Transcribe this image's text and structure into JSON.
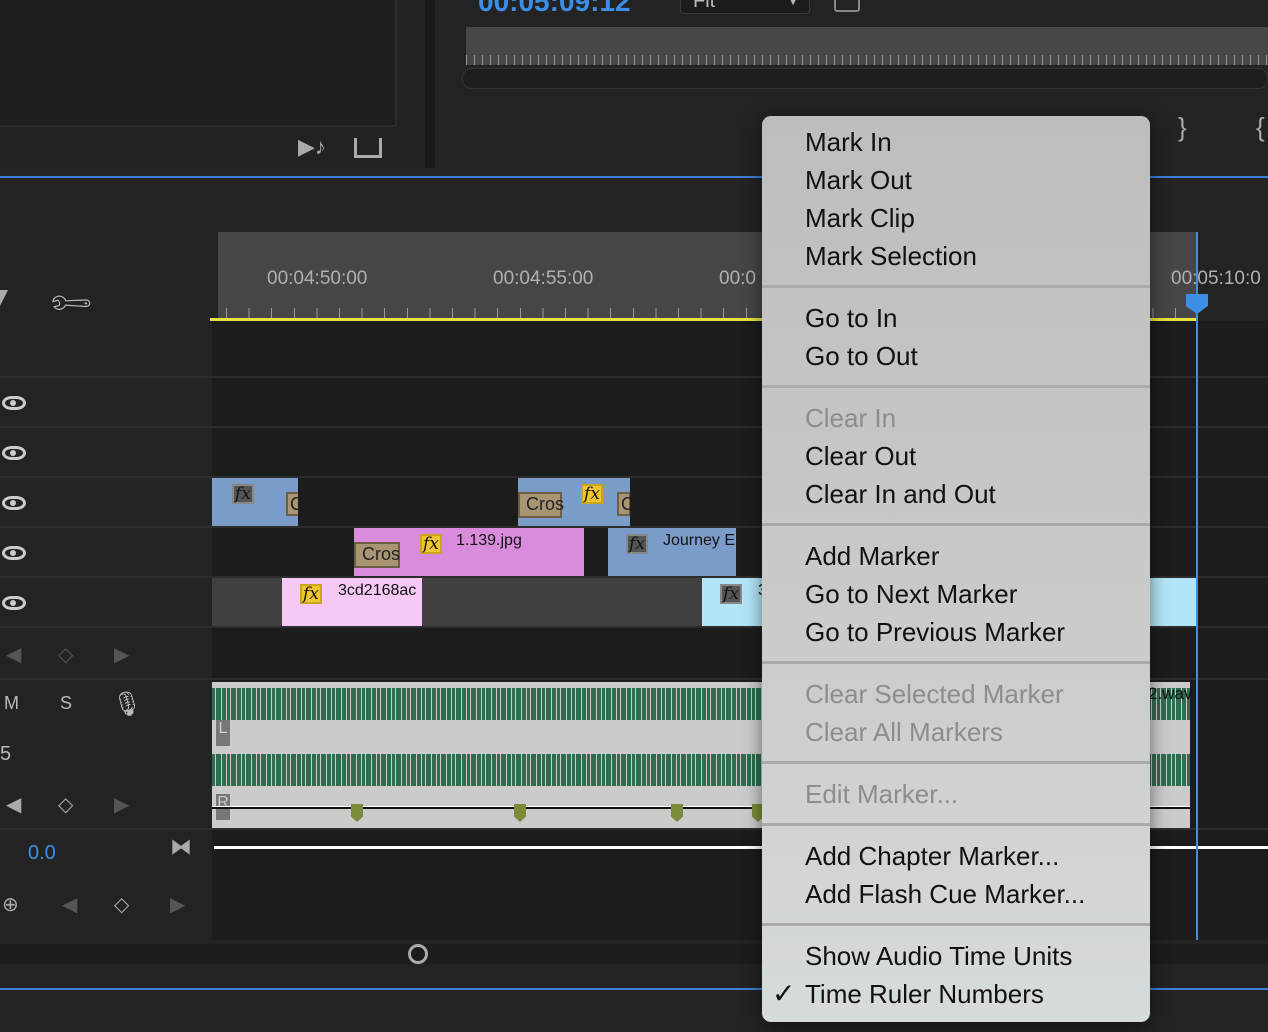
{
  "program_monitor": {
    "timecode": "00:05:09:12",
    "zoom_select": "Fit"
  },
  "timeline": {
    "ruler_labels": [
      "00:04:50:00",
      "00:04:55:00",
      "00:0",
      "00:05:10:0"
    ],
    "clips": {
      "v3_a_transition": "C",
      "v3_b_transition": "Cros",
      "v3_b_transition2": "C",
      "v2_pink_transition": "Cros",
      "v2_pink_name": "1.139.jpg",
      "v2_blue_name": "Journey E",
      "v1_pink_name": "3cd2168ac",
      "v1_blue_name": "3",
      "audio_name": "2.wav"
    },
    "audio_channels": {
      "left": "L",
      "right": "R"
    },
    "track_labels": {
      "mute": "M",
      "solo": "S",
      "track_num": "5"
    },
    "master_volume": "0.0",
    "colors": {
      "playhead": "#3d8ee6",
      "in_out_bar": "#e7e33c",
      "video_blue": "#7b9cc9",
      "video_pink": "#d98bdc",
      "video_light_pink": "#f5c8f5",
      "video_light_blue": "#b3e5f8",
      "waveform": "#2f6c50"
    }
  },
  "context_menu": {
    "groups": [
      [
        {
          "label": "Mark In",
          "enabled": true
        },
        {
          "label": "Mark Out",
          "enabled": true
        },
        {
          "label": "Mark Clip",
          "enabled": true
        },
        {
          "label": "Mark Selection",
          "enabled": true
        }
      ],
      [
        {
          "label": "Go to In",
          "enabled": true
        },
        {
          "label": "Go to Out",
          "enabled": true
        }
      ],
      [
        {
          "label": "Clear In",
          "enabled": false
        },
        {
          "label": "Clear Out",
          "enabled": true
        },
        {
          "label": "Clear In and Out",
          "enabled": true
        }
      ],
      [
        {
          "label": "Add Marker",
          "enabled": true
        },
        {
          "label": "Go to Next Marker",
          "enabled": true
        },
        {
          "label": "Go to Previous Marker",
          "enabled": true
        }
      ],
      [
        {
          "label": "Clear Selected Marker",
          "enabled": false
        },
        {
          "label": "Clear All Markers",
          "enabled": false
        }
      ],
      [
        {
          "label": "Edit Marker...",
          "enabled": false
        }
      ],
      [
        {
          "label": "Add Chapter Marker...",
          "enabled": true
        },
        {
          "label": "Add Flash Cue Marker...",
          "enabled": true
        }
      ],
      [
        {
          "label": "Show Audio Time Units",
          "enabled": true,
          "checked": false
        },
        {
          "label": "Time Ruler Numbers",
          "enabled": true,
          "checked": true
        }
      ]
    ],
    "check_glyph": "✓"
  }
}
